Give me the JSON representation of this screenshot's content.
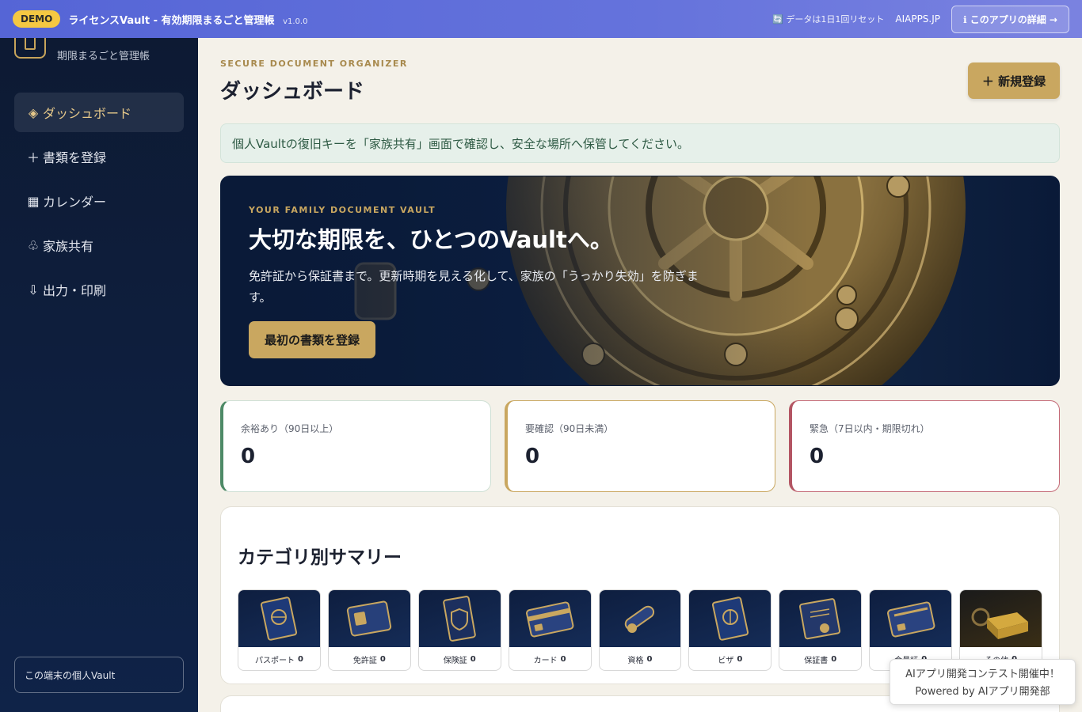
{
  "topbar": {
    "badge": "DEMO",
    "title": "ライセンスVault - 有効期限まるごと管理帳",
    "version": "v1.0.0",
    "reset_note": "🔄 データは1日1回リセット",
    "site": "AIAPPS.JP",
    "detail_button": "ℹ このアプリの詳細 →"
  },
  "sidebar": {
    "brand_sub": "期限まるごと管理帳",
    "items": [
      {
        "icon": "◈",
        "label": "ダッシュボード",
        "active": true
      },
      {
        "icon": "＋",
        "label": "書類を登録"
      },
      {
        "icon": "▦",
        "label": "カレンダー"
      },
      {
        "icon": "♧",
        "label": "家族共有"
      },
      {
        "icon": "⇩",
        "label": "出力・印刷"
      }
    ],
    "vault_button": "この端末の個人Vault"
  },
  "main": {
    "kicker": "SECURE DOCUMENT ORGANIZER",
    "title": "ダッシュボード",
    "new_button": "＋ 新規登録",
    "notice": "個人Vaultの復旧キーを「家族共有」画面で確認し、安全な場所へ保管してください。",
    "hero": {
      "kicker": "YOUR FAMILY DOCUMENT VAULT",
      "title": "大切な期限を、ひとつのVaultへ。",
      "desc": "免許証から保証書まで。更新時期を見える化して、家族の「うっかり失効」を防ぎます。",
      "button": "最初の書類を登録"
    },
    "stats": [
      {
        "label": "余裕あり（90日以上）",
        "value": "0"
      },
      {
        "label": "要確認（90日未満）",
        "value": "0"
      },
      {
        "label": "緊急（7日以内・期限切れ）",
        "value": "0"
      }
    ],
    "category_title": "カテゴリ別サマリー",
    "categories": [
      {
        "label": "パスポート",
        "count": "0",
        "icon": "passport-icon"
      },
      {
        "label": "免許証",
        "count": "0",
        "icon": "license-card-icon"
      },
      {
        "label": "保険証",
        "count": "0",
        "icon": "shield-card-icon"
      },
      {
        "label": "カード",
        "count": "0",
        "icon": "credit-card-icon"
      },
      {
        "label": "資格",
        "count": "0",
        "icon": "diploma-scroll-icon"
      },
      {
        "label": "ビザ",
        "count": "0",
        "icon": "visa-passport-icon"
      },
      {
        "label": "保証書",
        "count": "0",
        "icon": "warranty-certificate-icon"
      },
      {
        "label": "会員証",
        "count": "0",
        "icon": "member-card-icon"
      },
      {
        "label": "その他",
        "count": "0",
        "icon": "vault-drawer-icon"
      }
    ]
  },
  "contest": {
    "line1": "AIアプリ開発コンテスト開催中！",
    "line2": "Powered by AIアプリ開発部"
  },
  "colors": {
    "accent_gold": "#c9a760",
    "sidebar_navy": "#0d1a33",
    "ok_green": "#4e8a67",
    "urgent_red": "#b35563"
  }
}
